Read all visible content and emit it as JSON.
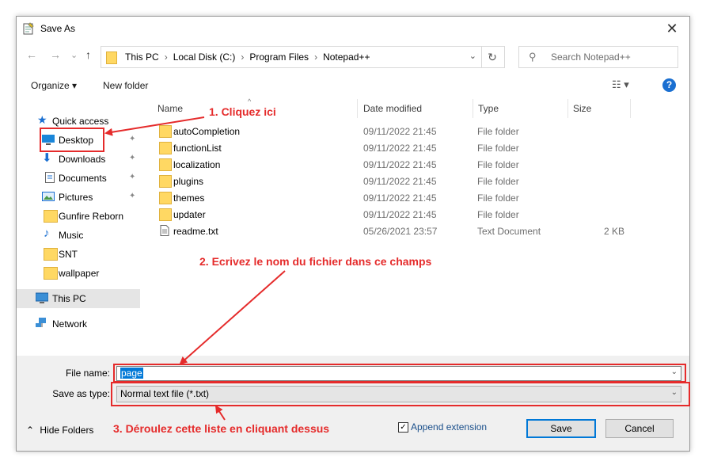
{
  "window": {
    "title": "Save As",
    "close_glyph": "✕"
  },
  "navigation": {
    "back_glyph": "←",
    "forward_glyph": "→",
    "recent_glyph": "⌄",
    "up_glyph": "↑",
    "breadcrumbs": [
      "This PC",
      "Local Disk (C:)",
      "Program Files",
      "Notepad++"
    ],
    "separator": "›",
    "dropdown_glyph": "⌄",
    "refresh_glyph": "↻",
    "search_placeholder": "Search Notepad++"
  },
  "toolbar": {
    "organize_label": "Organize ▾",
    "new_folder_label": "New folder",
    "view_glyph": "☷ ▾",
    "help_glyph": "?"
  },
  "sidebar": {
    "items": [
      {
        "label": "Quick access",
        "icon": "star-icon",
        "pinned": false
      },
      {
        "label": "Desktop",
        "icon": "desktop-icon",
        "pinned": true
      },
      {
        "label": "Downloads",
        "icon": "download-icon",
        "pinned": true
      },
      {
        "label": "Documents",
        "icon": "documents-icon",
        "pinned": true
      },
      {
        "label": "Pictures",
        "icon": "pictures-icon",
        "pinned": true
      },
      {
        "label": "Gunfire Reborn",
        "icon": "folder-icon",
        "pinned": false
      },
      {
        "label": "Music",
        "icon": "music-icon",
        "pinned": false
      },
      {
        "label": "SNT",
        "icon": "folder-icon",
        "pinned": false
      },
      {
        "label": "wallpaper",
        "icon": "folder-icon",
        "pinned": false
      },
      {
        "label": "This PC",
        "icon": "pc-icon",
        "pinned": false
      },
      {
        "label": "Network",
        "icon": "network-icon",
        "pinned": false
      }
    ],
    "pin_glyph": "📌"
  },
  "file_list": {
    "columns": [
      "Name",
      "Date modified",
      "Type",
      "Size"
    ],
    "sort_glyph": "^",
    "rows": [
      {
        "name": "autoCompletion",
        "date": "09/11/2022 21:45",
        "type": "File folder",
        "size": "",
        "icon": "folder-icon"
      },
      {
        "name": "functionList",
        "date": "09/11/2022 21:45",
        "type": "File folder",
        "size": "",
        "icon": "folder-icon"
      },
      {
        "name": "localization",
        "date": "09/11/2022 21:45",
        "type": "File folder",
        "size": "",
        "icon": "folder-icon"
      },
      {
        "name": "plugins",
        "date": "09/11/2022 21:45",
        "type": "File folder",
        "size": "",
        "icon": "folder-icon"
      },
      {
        "name": "themes",
        "date": "09/11/2022 21:45",
        "type": "File folder",
        "size": "",
        "icon": "folder-icon"
      },
      {
        "name": "updater",
        "date": "09/11/2022 21:45",
        "type": "File folder",
        "size": "",
        "icon": "folder-icon"
      },
      {
        "name": "readme.txt",
        "date": "05/26/2021 23:57",
        "type": "Text Document",
        "size": "2 KB",
        "icon": "text-file-icon"
      }
    ]
  },
  "save_form": {
    "file_name_label": "File name:",
    "file_name_value": "page",
    "save_as_type_label": "Save as type:",
    "save_as_type_value": "Normal text file (*.txt)",
    "dropdown_glyph": "⌄",
    "hide_folders_label": "Hide Folders",
    "hide_folders_glyph": "⌃",
    "append_extension_label": "Append extension",
    "append_extension_checked": true,
    "check_glyph": "✓",
    "save_label": "Save",
    "cancel_label": "Cancel"
  },
  "annotations": {
    "step1": "1. Cliquez ici",
    "step2": "2. Ecrivez le nom du fichier dans ce champs",
    "step3": "3. Déroulez cette liste en cliquant dessus",
    "color": "#e52b2b"
  },
  "colors": {
    "accent": "#0078d7",
    "folder": "#ffd863",
    "annotation_red": "#e52b2b"
  }
}
